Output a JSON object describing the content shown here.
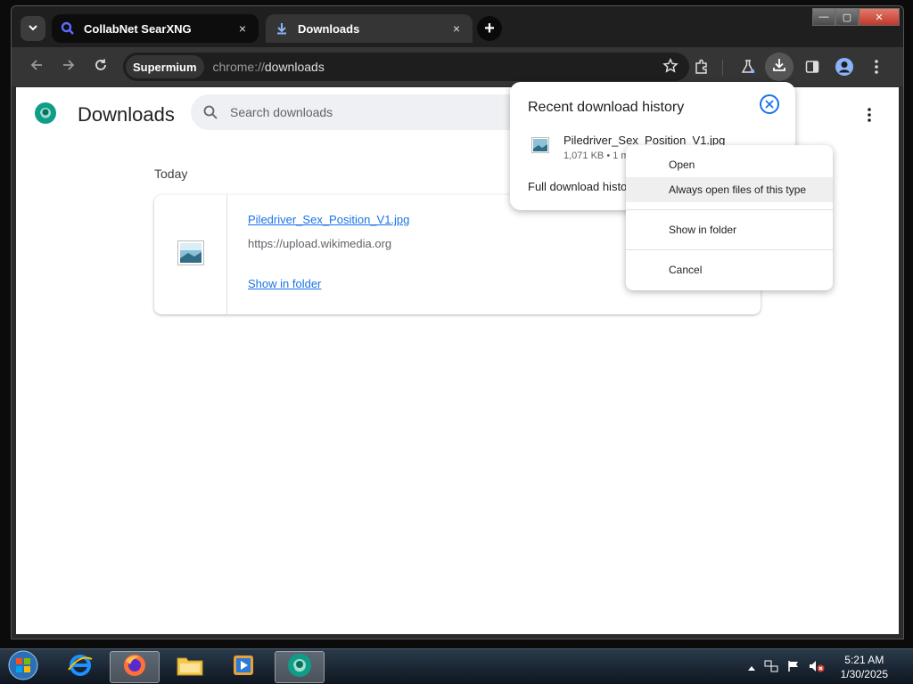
{
  "tabs": [
    {
      "title": "CollabNet SearXNG",
      "close": "×"
    },
    {
      "title": "Downloads",
      "close": "×"
    }
  ],
  "new_tab": "+",
  "window_controls": {
    "minimize": "—",
    "maximize": "▢",
    "close": "✕"
  },
  "toolbar": {
    "chip": "Supermium",
    "url_scheme": "chrome://",
    "url_path": "downloads"
  },
  "page": {
    "title": "Downloads",
    "search_placeholder": "Search downloads",
    "date_label": "Today",
    "download": {
      "filename": "Piledriver_Sex_Position_V1.jpg",
      "source": "https://upload.wikimedia.org",
      "show_in_folder": "Show in folder"
    }
  },
  "bubble": {
    "title": "Recent download history",
    "filename": "Piledriver_Sex_Position_V1.jpg",
    "meta": "1,071 KB • 1 m",
    "full_history": "Full download histo"
  },
  "context_menu": {
    "open": "Open",
    "always_open": "Always open files of this type",
    "show_in_folder": "Show in folder",
    "cancel": "Cancel"
  },
  "taskbar": {
    "clock_time": "5:21 AM",
    "clock_date": "1/30/2025"
  },
  "colors": {
    "accent": "#1a73e8",
    "tab_active": "#353535",
    "toolbar": "#353535",
    "page_bg": "#ffffff"
  }
}
